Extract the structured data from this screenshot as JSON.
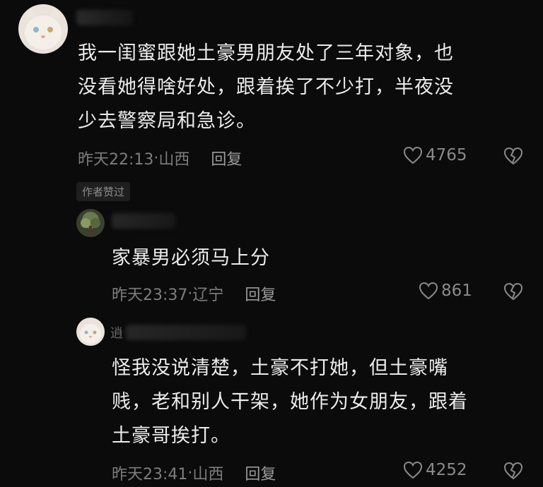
{
  "comments": [
    {
      "name_glyph": "",
      "text_lines": [
        "我一闺蜜跟她土豪男朋友处了三年对象，也",
        "没看她得啥好处，跟着挨了不少打，半夜没",
        "少去警察局和急诊。"
      ],
      "time": "昨天22:13",
      "location": "山西",
      "reply_label": "回复",
      "likes": "4765",
      "badge": "作者赞过"
    },
    {
      "name_glyph": "",
      "text_lines": [
        "家暴男必须马上分"
      ],
      "time": "昨天23:37",
      "location": "辽宁",
      "reply_label": "回复",
      "likes": "861"
    },
    {
      "name_glyph": "逍",
      "text_lines": [
        "怪我没说清楚，土豪不打她，但土豪嘴",
        "贱，老和别人干架，她作为女朋友，跟着",
        "土豪哥挨打。"
      ],
      "time": "昨天23:41",
      "location": "山西",
      "reply_label": "回复",
      "likes": "4252"
    }
  ],
  "separator": "·",
  "icons": {
    "like": "heart-outline-icon",
    "dislike": "broken-heart-icon"
  }
}
